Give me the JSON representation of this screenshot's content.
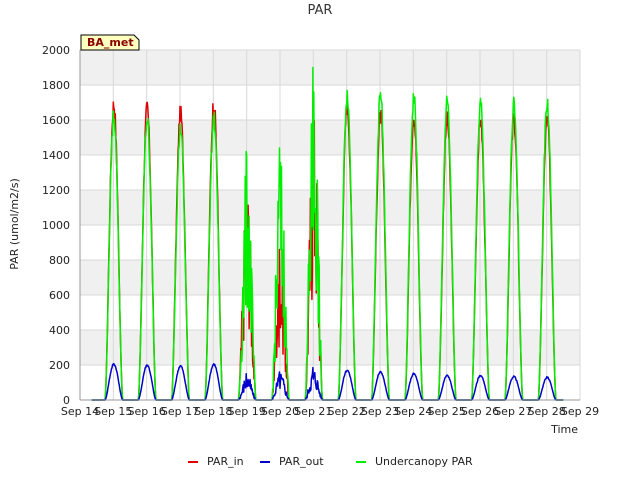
{
  "chart_data": {
    "type": "line",
    "title": "PAR",
    "xlabel": "Time",
    "ylabel": "PAR (umol/m2/s)",
    "site_label": "BA_met",
    "ylim": [
      0,
      2000
    ],
    "xlim": [
      0,
      15
    ],
    "yticks": [
      0,
      200,
      400,
      600,
      800,
      1000,
      1200,
      1400,
      1600,
      1800,
      2000
    ],
    "xticks": [
      "Sep 14",
      "Sep 15",
      "Sep 16",
      "Sep 17",
      "Sep 18",
      "Sep 19",
      "Sep 20",
      "Sep 21",
      "Sep 22",
      "Sep 23",
      "Sep 24",
      "Sep 25",
      "Sep 26",
      "Sep 27",
      "Sep 28",
      "Sep 29"
    ],
    "grid": true,
    "legend_position": "bottom",
    "series": [
      {
        "name": "PAR_in",
        "color": "#dd0000",
        "daily_peaks": [
          {
            "day": "Sep 15",
            "peak": 1690
          },
          {
            "day": "Sep 16",
            "peak": 1670
          },
          {
            "day": "Sep 17",
            "peak": 1640
          },
          {
            "day": "Sep 18",
            "peak": 1700
          },
          {
            "day": "Sep 19",
            "peak": 1280
          },
          {
            "day": "Sep 20",
            "peak": 860
          },
          {
            "day": "Sep 21",
            "peak": 1700
          },
          {
            "day": "Sep 22",
            "peak": 1680
          },
          {
            "day": "Sep 23",
            "peak": 1620
          },
          {
            "day": "Sep 24",
            "peak": 1620
          },
          {
            "day": "Sep 25",
            "peak": 1600
          },
          {
            "day": "Sep 26",
            "peak": 1600
          },
          {
            "day": "Sep 27",
            "peak": 1600
          },
          {
            "day": "Sep 28",
            "peak": 1600
          }
        ]
      },
      {
        "name": "PAR_out",
        "color": "#0000cc",
        "daily_peaks": [
          {
            "day": "Sep 15",
            "peak": 205
          },
          {
            "day": "Sep 16",
            "peak": 200
          },
          {
            "day": "Sep 17",
            "peak": 195
          },
          {
            "day": "Sep 18",
            "peak": 205
          },
          {
            "day": "Sep 19",
            "peak": 150
          },
          {
            "day": "Sep 20",
            "peak": 160
          },
          {
            "day": "Sep 21",
            "peak": 185
          },
          {
            "day": "Sep 22",
            "peak": 170
          },
          {
            "day": "Sep 23",
            "peak": 160
          },
          {
            "day": "Sep 24",
            "peak": 150
          },
          {
            "day": "Sep 25",
            "peak": 140
          },
          {
            "day": "Sep 26",
            "peak": 140
          },
          {
            "day": "Sep 27",
            "peak": 135
          },
          {
            "day": "Sep 28",
            "peak": 130
          }
        ]
      },
      {
        "name": "Undercanopy PAR",
        "color": "#00ee00",
        "daily_peaks": [
          {
            "day": "Sep 15",
            "peak": 1630
          },
          {
            "day": "Sep 16",
            "peak": 1610
          },
          {
            "day": "Sep 17",
            "peak": 1550
          },
          {
            "day": "Sep 18",
            "peak": 1610
          },
          {
            "day": "Sep 19",
            "peak": 1420
          },
          {
            "day": "Sep 20",
            "peak": 1440
          },
          {
            "day": "Sep 21",
            "peak": 1900
          },
          {
            "day": "Sep 22",
            "peak": 1750
          },
          {
            "day": "Sep 23",
            "peak": 1740
          },
          {
            "day": "Sep 24",
            "peak": 1730
          },
          {
            "day": "Sep 25",
            "peak": 1700
          },
          {
            "day": "Sep 26",
            "peak": 1690
          },
          {
            "day": "Sep 27",
            "peak": 1680
          },
          {
            "day": "Sep 28",
            "peak": 1700
          }
        ]
      }
    ]
  }
}
